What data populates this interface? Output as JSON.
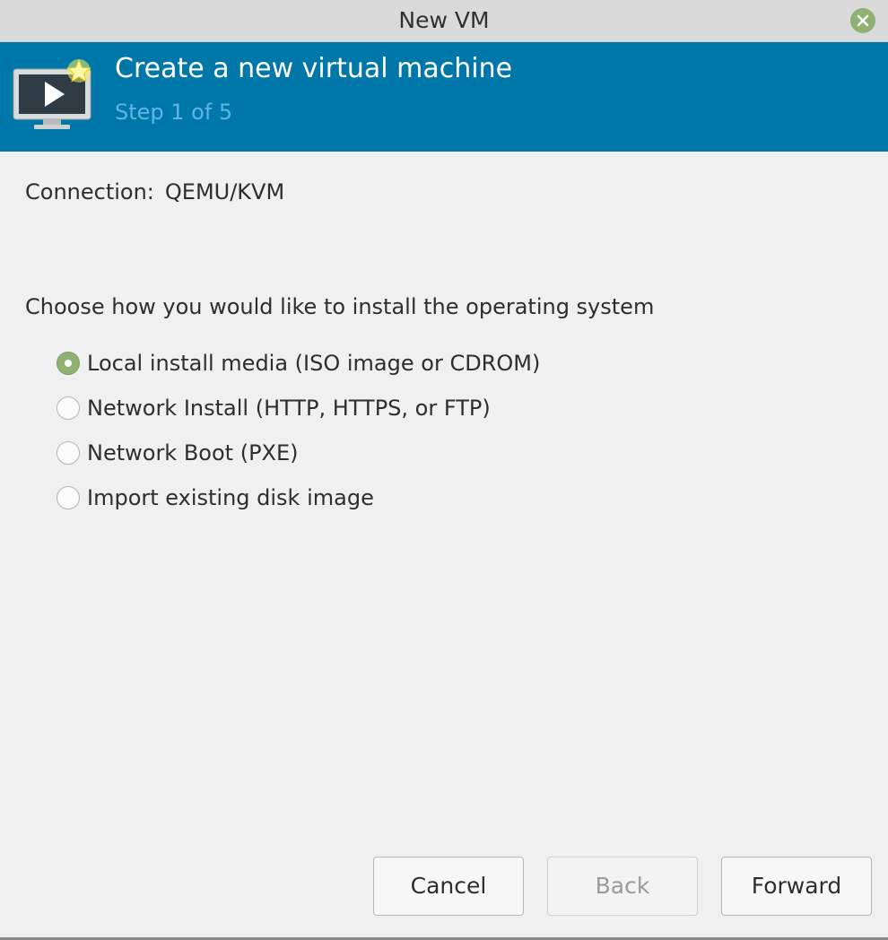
{
  "window": {
    "title": "New VM",
    "close_icon": "close-icon",
    "accent": "#8fb173"
  },
  "header": {
    "icon": "virtual-machine-icon",
    "title": "Create a new virtual machine",
    "step": "Step 1 of 5",
    "background": "#0077a9",
    "step_color": "#5fb6e3"
  },
  "connection": {
    "label": "Connection:",
    "value": "QEMU/KVM"
  },
  "install": {
    "prompt": "Choose how you would like to install the operating system",
    "options": [
      {
        "label": "Local install media (ISO image or CDROM)",
        "selected": true
      },
      {
        "label": "Network Install (HTTP, HTTPS, or FTP)",
        "selected": false
      },
      {
        "label": "Network Boot (PXE)",
        "selected": false
      },
      {
        "label": "Import existing disk image",
        "selected": false
      }
    ]
  },
  "buttons": {
    "cancel": "Cancel",
    "back": "Back",
    "back_enabled": false,
    "forward": "Forward"
  }
}
